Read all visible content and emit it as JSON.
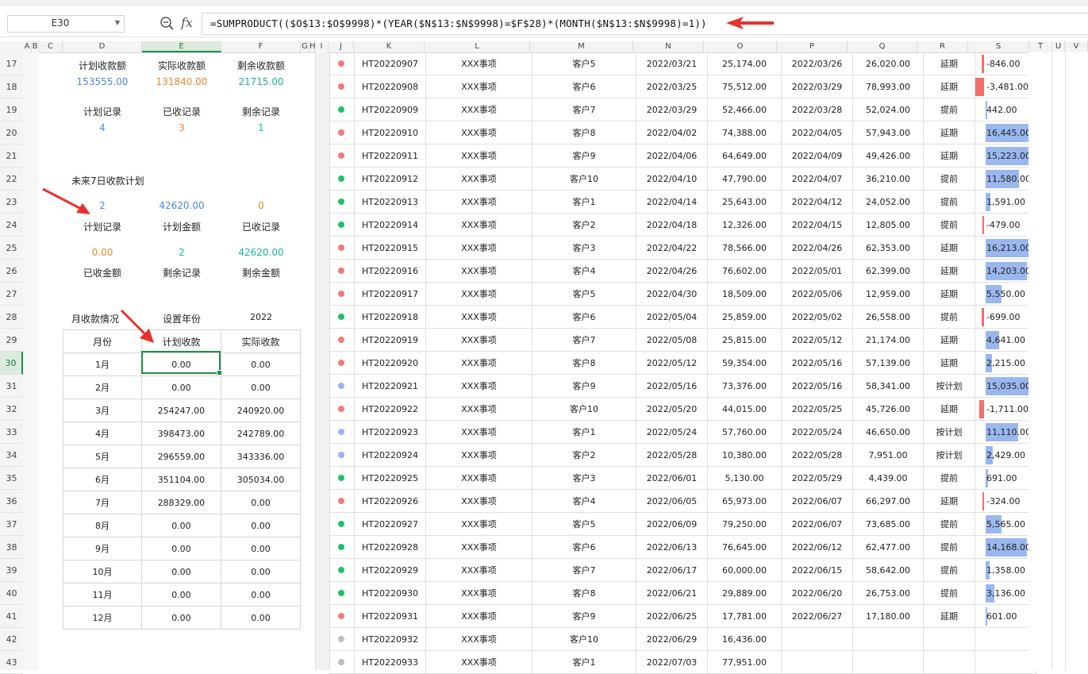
{
  "formula_bar": {
    "cell_ref": "E30",
    "formula": "=SUMPRODUCT(($O$13:$O$9998)*(YEAR($N$13:$N$9998)=$F$28)*(MONTH($N$13:$N$9998)=1))"
  },
  "columns": [
    "A",
    "B",
    "C",
    "D",
    "E",
    "F",
    "G",
    "H",
    "I",
    "J",
    "K",
    "L",
    "M",
    "N",
    "O",
    "P",
    "Q",
    "R",
    "S",
    "T",
    "U",
    "V"
  ],
  "rows": [
    "17",
    "18",
    "19",
    "20",
    "21",
    "22",
    "23",
    "24",
    "25",
    "26",
    "27",
    "28",
    "29",
    "30",
    "31",
    "32",
    "33",
    "34",
    "35",
    "36",
    "37",
    "38",
    "39",
    "40",
    "41",
    "42",
    "43"
  ],
  "summary": {
    "labels_top": [
      "计划收款额",
      "实际收款额",
      "剩余收款额"
    ],
    "values_top": [
      "153555.00",
      "131840.00",
      "21715.00"
    ],
    "labels_rec": [
      "计划记录",
      "已收记录",
      "剩余记录"
    ],
    "values_rec": [
      "4",
      "3",
      "1"
    ]
  },
  "seven_day": {
    "title": "未来7日收款计划",
    "values_a": [
      "2",
      "42620.00",
      "0"
    ],
    "labels_a": [
      "计划记录",
      "计划金额",
      "已收记录"
    ],
    "values_b": [
      "0.00",
      "2",
      "42620.00"
    ],
    "labels_b": [
      "已收金额",
      "剩余记录",
      "剩余金额"
    ]
  },
  "monthly": {
    "title": "月收款情况",
    "year_label": "设置年份",
    "year": "2022",
    "headers": [
      "月份",
      "计划收款",
      "实际收款"
    ],
    "rows": [
      [
        "1月",
        "0.00",
        "0.00"
      ],
      [
        "2月",
        "0.00",
        "0.00"
      ],
      [
        "3月",
        "254247.00",
        "240920.00"
      ],
      [
        "4月",
        "398473.00",
        "242789.00"
      ],
      [
        "5月",
        "296559.00",
        "343336.00"
      ],
      [
        "6月",
        "351104.00",
        "305034.00"
      ],
      [
        "7月",
        "288329.00",
        "0.00"
      ],
      [
        "8月",
        "0.00",
        "0.00"
      ],
      [
        "9月",
        "0.00",
        "0.00"
      ],
      [
        "10月",
        "0.00",
        "0.00"
      ],
      [
        "11月",
        "0.00",
        "0.00"
      ],
      [
        "12月",
        "0.00",
        "0.00"
      ]
    ]
  },
  "colors": {
    "red_dot": "#ef7b7b",
    "green_dot": "#20c06a",
    "blue_dot": "#9ab4ef",
    "gray_dot": "#bdbdbd",
    "pos_bar": "#9ab7ee",
    "neg_bar": "#f26d6d",
    "select": "#1f8e46",
    "arrow": "#e8312f"
  },
  "records": [
    {
      "dot": "red",
      "id": "HT20220907",
      "item": "XXX事项",
      "client": "客户5",
      "plan_date": "2022/03/21",
      "plan_amt": "25,174.00",
      "act_date": "2022/03/26",
      "act_amt": "26,020.00",
      "status": "延期",
      "diff": "-846.00",
      "diff_num": -846
    },
    {
      "dot": "red",
      "id": "HT20220908",
      "item": "XXX事项",
      "client": "客户6",
      "plan_date": "2022/03/25",
      "plan_amt": "75,512.00",
      "act_date": "2022/03/29",
      "act_amt": "78,993.00",
      "status": "延期",
      "diff": "-3,481.00",
      "diff_num": -3481
    },
    {
      "dot": "green",
      "id": "HT20220909",
      "item": "XXX事项",
      "client": "客户7",
      "plan_date": "2022/03/29",
      "plan_amt": "52,466.00",
      "act_date": "2022/03/28",
      "act_amt": "52,024.00",
      "status": "提前",
      "diff": "442.00",
      "diff_num": 442
    },
    {
      "dot": "red",
      "id": "HT20220910",
      "item": "XXX事项",
      "client": "客户8",
      "plan_date": "2022/04/02",
      "plan_amt": "74,388.00",
      "act_date": "2022/04/05",
      "act_amt": "57,943.00",
      "status": "延期",
      "diff": "16,445.00",
      "diff_num": 16445
    },
    {
      "dot": "red",
      "id": "HT20220911",
      "item": "XXX事项",
      "client": "客户9",
      "plan_date": "2022/04/06",
      "plan_amt": "64,649.00",
      "act_date": "2022/04/09",
      "act_amt": "49,426.00",
      "status": "延期",
      "diff": "15,223.00",
      "diff_num": 15223
    },
    {
      "dot": "green",
      "id": "HT20220912",
      "item": "XXX事项",
      "client": "客户10",
      "plan_date": "2022/04/10",
      "plan_amt": "47,790.00",
      "act_date": "2022/04/07",
      "act_amt": "36,210.00",
      "status": "提前",
      "diff": "11,580.00",
      "diff_num": 11580
    },
    {
      "dot": "green",
      "id": "HT20220913",
      "item": "XXX事项",
      "client": "客户1",
      "plan_date": "2022/04/14",
      "plan_amt": "25,643.00",
      "act_date": "2022/04/12",
      "act_amt": "24,052.00",
      "status": "提前",
      "diff": "1,591.00",
      "diff_num": 1591
    },
    {
      "dot": "green",
      "id": "HT20220914",
      "item": "XXX事项",
      "client": "客户2",
      "plan_date": "2022/04/18",
      "plan_amt": "12,326.00",
      "act_date": "2022/04/15",
      "act_amt": "12,805.00",
      "status": "提前",
      "diff": "-479.00",
      "diff_num": -479
    },
    {
      "dot": "red",
      "id": "HT20220915",
      "item": "XXX事项",
      "client": "客户3",
      "plan_date": "2022/04/22",
      "plan_amt": "78,566.00",
      "act_date": "2022/04/26",
      "act_amt": "62,353.00",
      "status": "延期",
      "diff": "16,213.00",
      "diff_num": 16213
    },
    {
      "dot": "red",
      "id": "HT20220916",
      "item": "XXX事项",
      "client": "客户4",
      "plan_date": "2022/04/26",
      "plan_amt": "76,602.00",
      "act_date": "2022/05/01",
      "act_amt": "62,399.00",
      "status": "延期",
      "diff": "14,203.00",
      "diff_num": 14203
    },
    {
      "dot": "red",
      "id": "HT20220917",
      "item": "XXX事项",
      "client": "客户5",
      "plan_date": "2022/04/30",
      "plan_amt": "18,509.00",
      "act_date": "2022/05/06",
      "act_amt": "12,959.00",
      "status": "延期",
      "diff": "5,550.00",
      "diff_num": 5550
    },
    {
      "dot": "green",
      "id": "HT20220918",
      "item": "XXX事项",
      "client": "客户6",
      "plan_date": "2022/05/04",
      "plan_amt": "25,859.00",
      "act_date": "2022/05/02",
      "act_amt": "26,558.00",
      "status": "提前",
      "diff": "-699.00",
      "diff_num": -699
    },
    {
      "dot": "red",
      "id": "HT20220919",
      "item": "XXX事项",
      "client": "客户7",
      "plan_date": "2022/05/08",
      "plan_amt": "25,815.00",
      "act_date": "2022/05/12",
      "act_amt": "21,174.00",
      "status": "延期",
      "diff": "4,641.00",
      "diff_num": 4641
    },
    {
      "dot": "red",
      "id": "HT20220920",
      "item": "XXX事项",
      "client": "客户8",
      "plan_date": "2022/05/12",
      "plan_amt": "59,354.00",
      "act_date": "2022/05/16",
      "act_amt": "57,139.00",
      "status": "延期",
      "diff": "2,215.00",
      "diff_num": 2215
    },
    {
      "dot": "blue",
      "id": "HT20220921",
      "item": "XXX事项",
      "client": "客户9",
      "plan_date": "2022/05/16",
      "plan_amt": "73,376.00",
      "act_date": "2022/05/16",
      "act_amt": "58,341.00",
      "status": "按计划",
      "diff": "15,035.00",
      "diff_num": 15035
    },
    {
      "dot": "red",
      "id": "HT20220922",
      "item": "XXX事项",
      "client": "客户10",
      "plan_date": "2022/05/20",
      "plan_amt": "44,015.00",
      "act_date": "2022/05/25",
      "act_amt": "45,726.00",
      "status": "延期",
      "diff": "-1,711.00",
      "diff_num": -1711
    },
    {
      "dot": "blue",
      "id": "HT20220923",
      "item": "XXX事项",
      "client": "客户1",
      "plan_date": "2022/05/24",
      "plan_amt": "57,760.00",
      "act_date": "2022/05/24",
      "act_amt": "46,650.00",
      "status": "按计划",
      "diff": "11,110.00",
      "diff_num": 11110
    },
    {
      "dot": "blue",
      "id": "HT20220924",
      "item": "XXX事项",
      "client": "客户2",
      "plan_date": "2022/05/28",
      "plan_amt": "10,380.00",
      "act_date": "2022/05/28",
      "act_amt": "7,951.00",
      "status": "按计划",
      "diff": "2,429.00",
      "diff_num": 2429
    },
    {
      "dot": "green",
      "id": "HT20220925",
      "item": "XXX事项",
      "client": "客户3",
      "plan_date": "2022/06/01",
      "plan_amt": "5,130.00",
      "act_date": "2022/05/29",
      "act_amt": "4,439.00",
      "status": "提前",
      "diff": "691.00",
      "diff_num": 691
    },
    {
      "dot": "red",
      "id": "HT20220926",
      "item": "XXX事项",
      "client": "客户4",
      "plan_date": "2022/06/05",
      "plan_amt": "65,973.00",
      "act_date": "2022/06/07",
      "act_amt": "66,297.00",
      "status": "延期",
      "diff": "-324.00",
      "diff_num": -324
    },
    {
      "dot": "green",
      "id": "HT20220927",
      "item": "XXX事项",
      "client": "客户5",
      "plan_date": "2022/06/09",
      "plan_amt": "79,250.00",
      "act_date": "2022/06/07",
      "act_amt": "73,685.00",
      "status": "提前",
      "diff": "5,565.00",
      "diff_num": 5565
    },
    {
      "dot": "green",
      "id": "HT20220928",
      "item": "XXX事项",
      "client": "客户6",
      "plan_date": "2022/06/13",
      "plan_amt": "76,645.00",
      "act_date": "2022/06/12",
      "act_amt": "62,477.00",
      "status": "提前",
      "diff": "14,168.00",
      "diff_num": 14168
    },
    {
      "dot": "green",
      "id": "HT20220929",
      "item": "XXX事项",
      "client": "客户7",
      "plan_date": "2022/06/17",
      "plan_amt": "60,000.00",
      "act_date": "2022/06/15",
      "act_amt": "58,642.00",
      "status": "提前",
      "diff": "1,358.00",
      "diff_num": 1358
    },
    {
      "dot": "green",
      "id": "HT20220930",
      "item": "XXX事项",
      "client": "客户8",
      "plan_date": "2022/06/21",
      "plan_amt": "29,889.00",
      "act_date": "2022/06/20",
      "act_amt": "26,753.00",
      "status": "提前",
      "diff": "3,136.00",
      "diff_num": 3136
    },
    {
      "dot": "red",
      "id": "HT20220931",
      "item": "XXX事项",
      "client": "客户9",
      "plan_date": "2022/06/25",
      "plan_amt": "17,781.00",
      "act_date": "2022/06/27",
      "act_amt": "17,180.00",
      "status": "延期",
      "diff": "601.00",
      "diff_num": 601
    },
    {
      "dot": "gray",
      "id": "HT20220932",
      "item": "XXX事项",
      "client": "客户10",
      "plan_date": "2022/06/29",
      "plan_amt": "16,436.00",
      "act_date": "",
      "act_amt": "",
      "status": "",
      "diff": "",
      "diff_num": 0
    },
    {
      "dot": "gray",
      "id": "HT20220933",
      "item": "XXX事项",
      "client": "客户1",
      "plan_date": "2022/07/03",
      "plan_amt": "77,951.00",
      "act_date": "",
      "act_amt": "",
      "status": "",
      "diff": "",
      "diff_num": 0
    }
  ]
}
